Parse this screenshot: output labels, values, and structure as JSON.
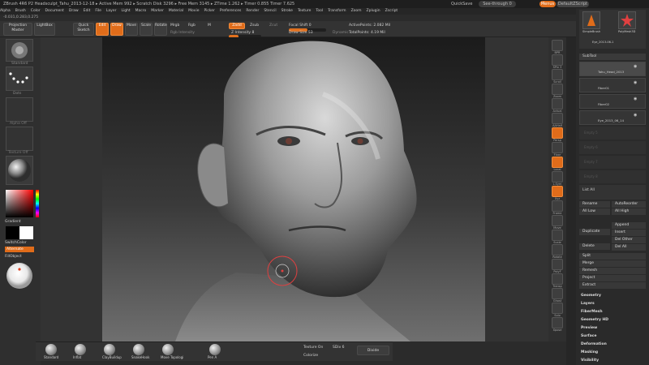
{
  "title_bar": {
    "text": "ZBrush 4R6 P2   Headsculpt_Tahu_2013-12-18   ▸ Active Mem 992  ▸ Scratch Disk 3296  ▸ Free Mem 3145  ▸ ZTime 1.262  ▸ Timer 0.855  Timer 7.625",
    "quicksave": "QuickSave",
    "see_through": "See-through",
    "see_through_value": "0",
    "menus": "Menus",
    "script": "DefaultZScript"
  },
  "menubar": [
    "Alpha",
    "Brush",
    "Color",
    "Document",
    "Draw",
    "Edit",
    "File",
    "Layer",
    "Light",
    "Macro",
    "Marker",
    "Material",
    "Movie",
    "Picker",
    "Preferences",
    "Render",
    "Stencil",
    "Stroke",
    "Texture",
    "Tool",
    "Transform",
    "Zoom",
    "Zplugin",
    "Zscript"
  ],
  "coords": "-0.031,0.283,0.275",
  "toolbar": {
    "projection_master": "Projection Master",
    "lightbox": "LightBox",
    "quick_sketch": "Quick Sketch",
    "edit": "Edit",
    "draw": "Draw",
    "move": "Move",
    "scale": "Scale",
    "rotate": "Rotate",
    "mrgb": "Mrgb",
    "rgb": "Rgb",
    "m": "M",
    "rgb_intensity": "Rgb Intensity",
    "zadd": "Zadd",
    "zsub": "Zsub",
    "zcut": "Zcut",
    "z_intensity": "Z Intensity 8",
    "focal_shift": "Focal Shift 0",
    "draw_size": "Draw Size 53",
    "dynamic": "Dynamic",
    "active_points": "ActivePoints: 2.082 Mil",
    "total_points": "TotalPoints: 4.19 Mil"
  },
  "left_shelf": {
    "brush": "Standard",
    "stroke": "Dots",
    "alpha": "Alpha Off",
    "texture": "Texture Off",
    "material": "",
    "gradient": "Gradient",
    "switch_color": "SwitchColor",
    "alternate": "Alternate",
    "fill_object": "FillObject"
  },
  "right_strip": [
    "BPR",
    "SPix 3",
    "Scroll",
    "Zoom",
    "Actual",
    "AAHalf",
    "Persp",
    "Floor",
    "Local",
    "L.Sym",
    "Xyz",
    "Frame",
    "Move",
    "Scale",
    "Rotate",
    "PolyF",
    "Transp",
    "Ghost",
    "Solo",
    "Xpose"
  ],
  "right_panel": {
    "tool_thumbs": [
      "SimpleBrush",
      "PolyMesh3D",
      "Eye_2013-06-1"
    ],
    "subtool_header": "SubTool",
    "subtools": [
      "Tahu_Head_2013",
      "Fiber01",
      "Fiber02",
      "Eye_2013_06_14"
    ],
    "empty_slots": [
      "Empty 5",
      "Empty 6",
      "Empty 7",
      "Empty 8"
    ],
    "list_all": "List All",
    "rename": "Rename",
    "auto_reorder": "AutoReorder",
    "all_low": "All Low",
    "all_high": "All High",
    "append": "Append",
    "duplicate": "Duplicate",
    "insert": "Insert",
    "delete": "Delete",
    "del_other": "Del Other",
    "del_all": "Del All",
    "split": "Split",
    "merge": "Merge",
    "remesh": "Remesh",
    "project": "Project",
    "extract": "Extract",
    "sections": [
      "Geometry",
      "Layers",
      "FiberMesh",
      "Geometry HD",
      "Preview",
      "Surface",
      "Deformation",
      "Masking",
      "Visibility"
    ]
  },
  "bottom_shelf": {
    "brushes": [
      "Standard",
      "Inflat",
      "ClayBuildup",
      "SnakeHook",
      "Move Topologi",
      "Pen A"
    ],
    "texture_on": "Texture On",
    "sdiv": "SDiv 6",
    "divide": "Divide",
    "colorize": "Colorize"
  },
  "colors": {
    "accent": "#e06c1a",
    "panel": "#2f2f2f",
    "background": "#2b2b2b"
  }
}
